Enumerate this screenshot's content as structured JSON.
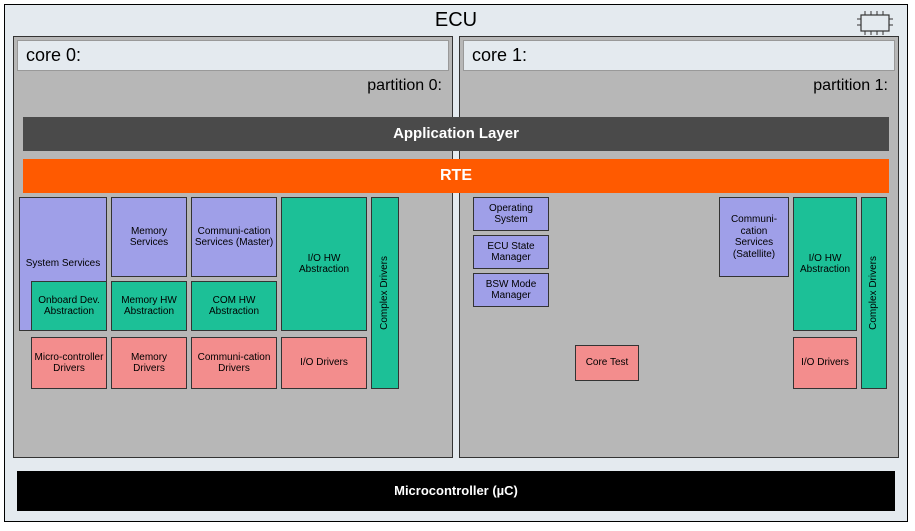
{
  "ecu": {
    "title": "ECU"
  },
  "core0": {
    "title": "core 0:",
    "partition": "partition 0:"
  },
  "core1": {
    "title": "core 1:",
    "partition": "partition 1:"
  },
  "layers": {
    "app": "Application Layer",
    "rte": "RTE",
    "mc": "Microcontroller (µC)"
  },
  "c0": {
    "sys": "System Services",
    "mem": "Memory Services",
    "com": "Communi-cation Services (Master)",
    "iohw": "I/O HW Abstraction",
    "complex": "Complex Drivers",
    "onboard": "Onboard Dev. Abstraction",
    "memhw": "Memory HW Abstraction",
    "comhw": "COM HW Abstraction",
    "microdrv": "Micro-controller Drivers",
    "memdrv": "Memory Drivers",
    "comdrv": "Communi-cation Drivers",
    "iodrv": "I/O Drivers"
  },
  "c1": {
    "os": "Operating System",
    "ecusm": "ECU State Manager",
    "bswmm": "BSW Mode Manager",
    "coretest": "Core Test",
    "comsat": "Communi-cation Services (Satellite)",
    "iohw": "I/O HW Abstraction",
    "complex": "Complex Drivers",
    "iodrv": "I/O Drivers"
  }
}
